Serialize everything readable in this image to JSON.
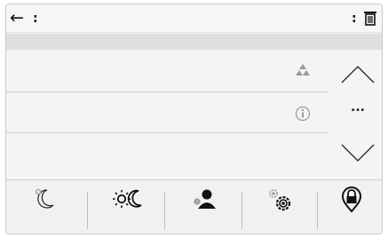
{
  "topbar": {
    "back_icon": "arrow-left-icon",
    "left_separator": ":",
    "right_separator": ":",
    "trash_icon": "trash-icon"
  },
  "list": {
    "rows": [
      {
        "icon": "warning-triangles-icon"
      },
      {
        "icon": "info-icon"
      },
      {
        "icon": null
      }
    ]
  },
  "side_controls": {
    "up_icon": "chevron-up-icon",
    "more_label": "...",
    "down_icon": "chevron-down-icon"
  },
  "bottom_bar": {
    "buttons": [
      {
        "icon": "night-mode-icon"
      },
      {
        "icon": "day-night-icon"
      },
      {
        "icon": "user-help-icon"
      },
      {
        "icon": "settings-gears-icon"
      },
      {
        "icon": "privacy-lock-location-icon"
      }
    ]
  },
  "colors": {
    "background": "#f4f4f4",
    "strip": "#dfdfdf",
    "icon_gray": "#9a9a9a",
    "dark": "#1a1a1a"
  }
}
